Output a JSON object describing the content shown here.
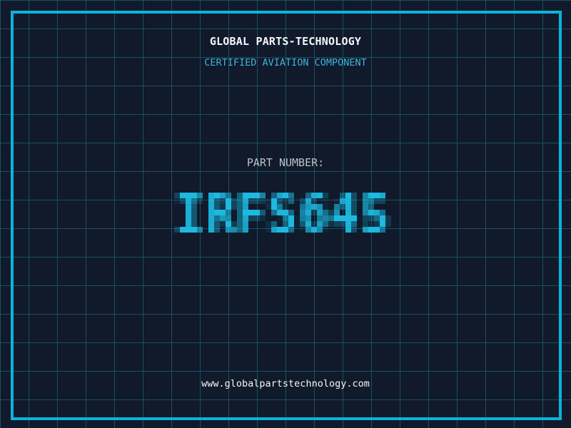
{
  "header": {
    "title": "GLOBAL PARTS-TECHNOLOGY",
    "subtitle": "CERTIFIED AVIATION COMPONENT"
  },
  "part_number": {
    "label": "PART NUMBER:",
    "value": "IRFS645"
  },
  "footer": {
    "website": "www.globalpartstechnology.com"
  },
  "colors": {
    "background": "#101a2a",
    "grid_line": "#1c4e66",
    "frame_border": "#0cb2da",
    "part_number_accent": "#1db9e0",
    "subtitle_cyan": "#3fb3da",
    "label_gray": "#b9c2cc",
    "text_white": "#f5f7fa"
  }
}
